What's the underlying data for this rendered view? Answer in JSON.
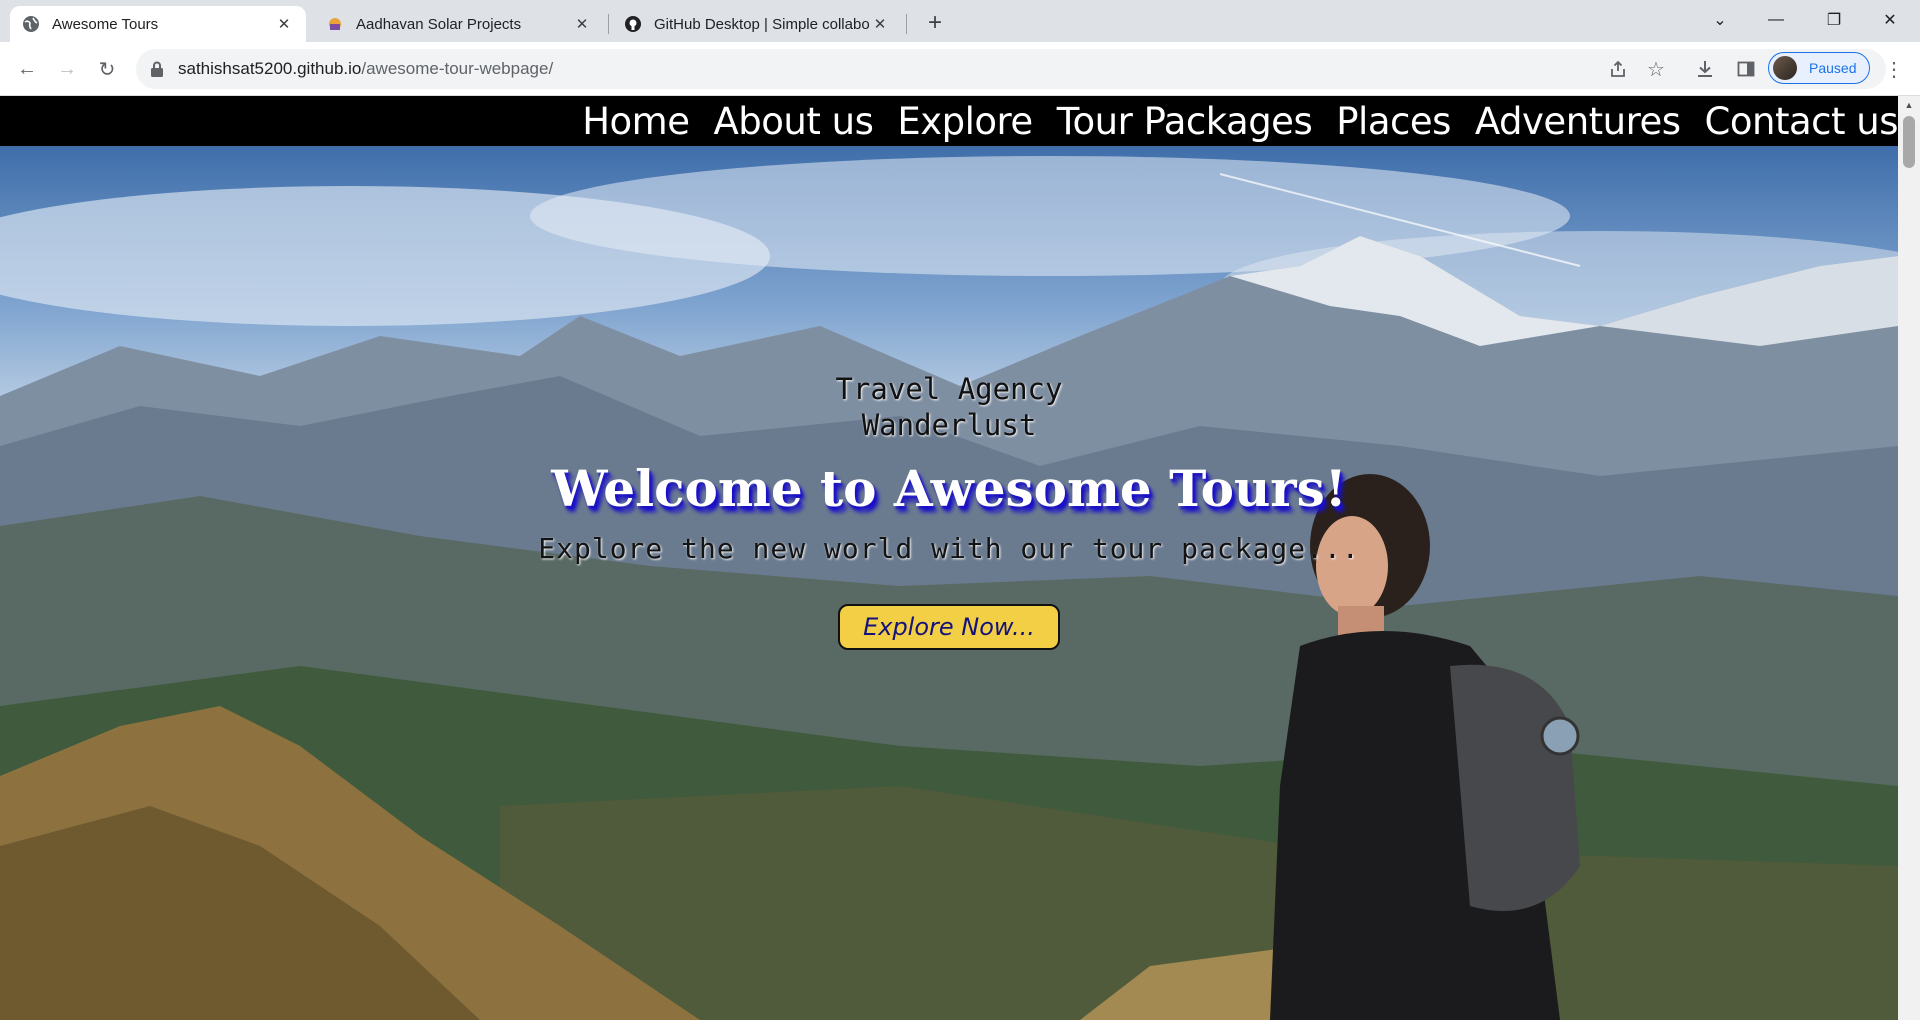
{
  "browser": {
    "tabs": [
      {
        "title": "Awesome Tours",
        "icon": "globe-icon",
        "active": true
      },
      {
        "title": "Aadhavan Solar Projects",
        "icon": "solar-favicon-icon",
        "active": false
      },
      {
        "title": "GitHub Desktop | Simple collabo",
        "icon": "github-icon",
        "active": false
      }
    ],
    "url_host": "sathishsat5200.github.io",
    "url_path": "/awesome-tour-webpage/",
    "profile_label": "Paused",
    "accent_color": "#1a73e8"
  },
  "site": {
    "nav": [
      "Home",
      "About us",
      "Explore",
      "Tour Packages",
      "Places",
      "Adventures",
      "Contact us"
    ],
    "hero": {
      "tagline_1": "Travel Agency",
      "tagline_2": "Wanderlust",
      "headline": "Welcome to Awesome Tours!",
      "subline": "Explore the new world with our tour package...",
      "cta_label": "Explore Now...",
      "cta_color": "#f2cf45",
      "headline_shadow_color": "#1a10c8"
    }
  }
}
